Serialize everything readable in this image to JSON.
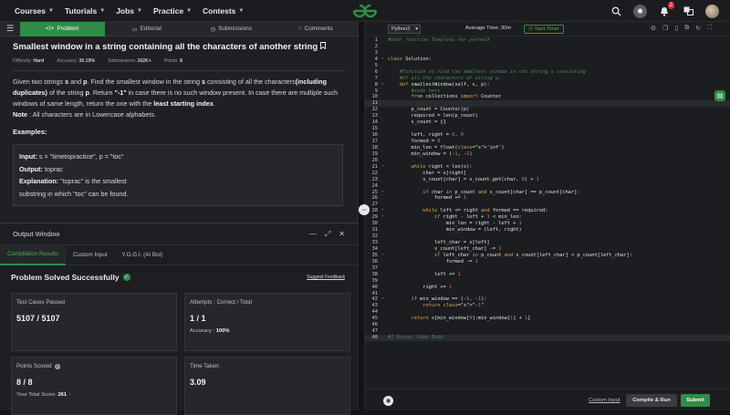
{
  "nav": {
    "items": [
      "Courses",
      "Tutorials",
      "Jobs",
      "Practice",
      "Contests"
    ],
    "notif_count": "2"
  },
  "problem_tabs": [
    "Problem",
    "Editorial",
    "Submissions",
    "Comments"
  ],
  "problem": {
    "title": "Smallest window in a string containing all the characters of another string",
    "difficulty_label": "Difficulty:",
    "difficulty": "Hard",
    "accuracy_label": "Accuracy:",
    "accuracy": "30.19%",
    "submissions_label": "Submissions:",
    "submissions": "162K+",
    "points_label": "Points:",
    "points": "8",
    "desc_1a": "Given two strings ",
    "desc_1b": "s",
    "desc_1c": " and ",
    "desc_1d": "p",
    "desc_1e": ". Find the smallest window in the string ",
    "desc_1f": "s",
    "desc_1g": " consisting of all the characters",
    "desc_1h": "(including duplicates)",
    "desc_1i": " of the string ",
    "desc_1j": "p",
    "desc_1k": ".  Return ",
    "desc_1l": "\"-1\"",
    "desc_1m": " in case there is no such window present. In case there are multiple such windows of same length, return the one with the ",
    "desc_1n": "least starting index",
    "desc_1o": ".",
    "note_label": "Note",
    "note_text": " : All characters are in Lowercase alphabets.",
    "examples_heading": "Examples:",
    "ex_input_label": "Input:",
    "ex_input": " s = \"timetopractice\", p = \"toc\"",
    "ex_output_label": "Output:",
    "ex_output": " toprac",
    "ex_expl_label": "Explanation:",
    "ex_expl_1": " \"toprac\" is the smallest",
    "ex_expl_2": "substring in which \"toc\" can be found."
  },
  "output": {
    "title": "Output Window",
    "tabs": [
      "Compilation Results",
      "Custom Input",
      "Y.O.G.I. (AI Bot)"
    ],
    "status": "Problem Solved Successfully",
    "feedback": "Suggest Feedback",
    "cards": {
      "tests_label": "Test Cases Passed",
      "tests_value": "5107 / 5107",
      "attempts_label": "Attempts : Correct / Total",
      "attempts_value": "1 / 1",
      "accuracy_label": "Accuracy :",
      "accuracy_value": "100%",
      "points_label": "Points Scored",
      "points_value": "8 / 8",
      "total_label": "Your Total Score:",
      "total_value": "261",
      "time_label": "Time Taken",
      "time_value": "3.09"
    }
  },
  "editor": {
    "language": "Python3",
    "avg_time": "Average Time: 30m",
    "timer": "Start Timer",
    "custom_input": "Custom Input",
    "compile_run": "Compile & Run",
    "submit": "Submit"
  },
  "code_lines": [
    "#User function Template for python3",
    "",
    "",
    "class Solution:",
    "",
    "    #Function to find the smallest window in the string s consisting",
    "    #of all the characters of string p.",
    "    def smallestWindow(self, s, p):",
    "        #code here",
    "        from collections import Counter",
    "",
    "        p_count = Counter(p)",
    "        required = len(p_count)",
    "        s_count = {}",
    "",
    "        left, right = 0, 0",
    "        formed = 0",
    "        min_len = float('inf')",
    "        min_window = (-1, -1)",
    "",
    "        while right < len(s):",
    "            char = s[right]",
    "            s_count[char] = s_count.get(char, 0) + 1",
    "",
    "            if char in p_count and s_count[char] == p_count[char]:",
    "                formed += 1",
    "",
    "            while left <= right and formed == required:",
    "                if right - left + 1 < min_len:",
    "                    min_len = right - left + 1",
    "                    min_window = (left, right)",
    "",
    "                left_char = s[left]",
    "                s_count[left_char] -= 1",
    "                if left_char in p_count and s_count[left_char] < p_count[left_char]:",
    "                    formed -= 1",
    "",
    "                left += 1",
    "",
    "            right += 1",
    "",
    "        if min_window == (-1, -1):",
    "            return \"-1\"",
    "",
    "        return s[min_window[0]:min_window[1] + 1]",
    "",
    "",
    "#{ Driver Code Ends"
  ]
}
